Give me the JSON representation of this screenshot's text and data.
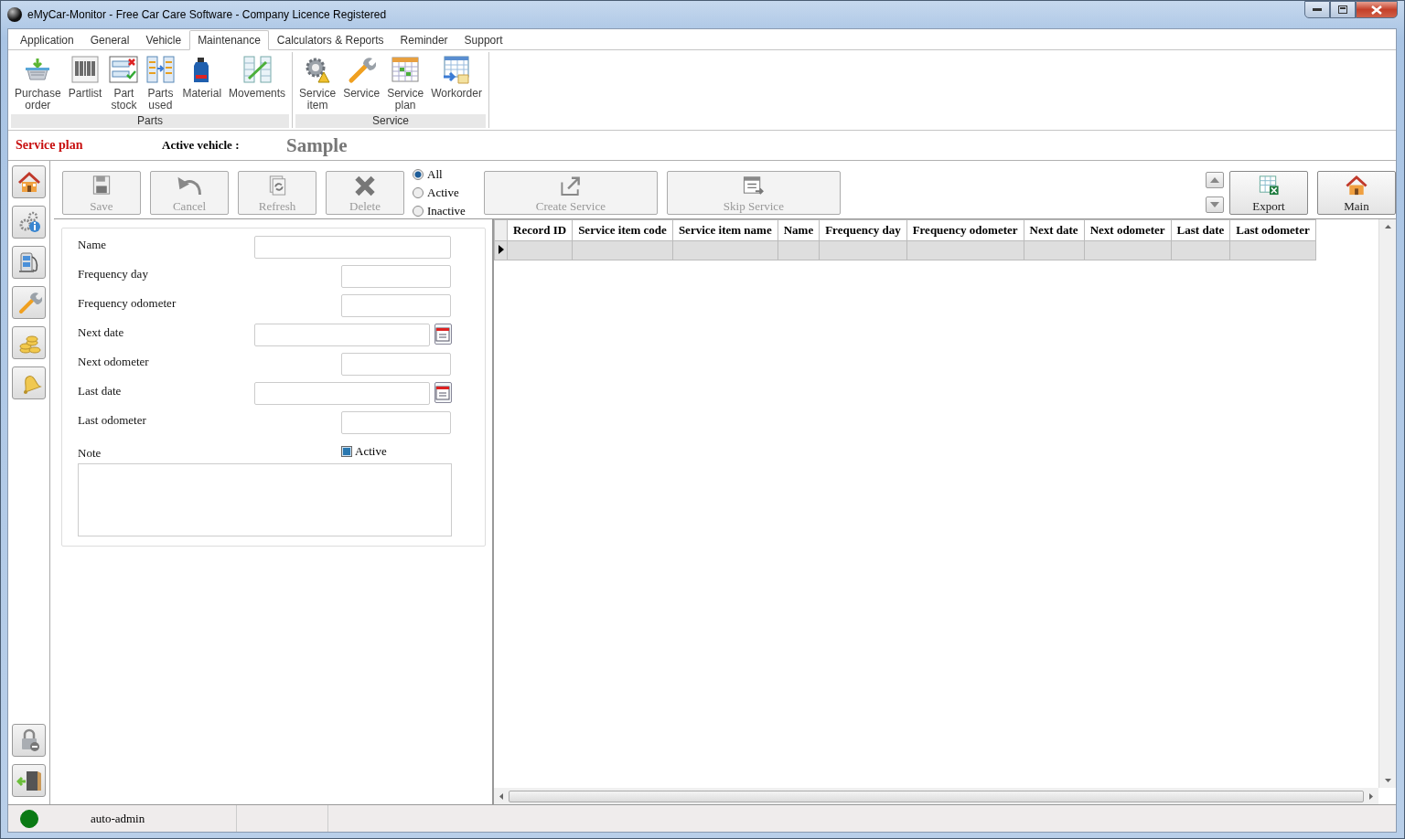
{
  "window": {
    "title": "eMyCar-Monitor - Free Car Care Software - Company Licence Registered"
  },
  "ribbon": {
    "tabs": [
      {
        "label": "Application",
        "selected": false
      },
      {
        "label": "General",
        "selected": false
      },
      {
        "label": "Vehicle",
        "selected": false
      },
      {
        "label": "Maintenance",
        "selected": true
      },
      {
        "label": "Calculators & Reports",
        "selected": false
      },
      {
        "label": "Reminder",
        "selected": false
      },
      {
        "label": "Support",
        "selected": false
      }
    ],
    "groups": [
      {
        "label": "Parts",
        "items": [
          {
            "label": "Purchase\norder"
          },
          {
            "label": "Partlist"
          },
          {
            "label": "Part\nstock"
          },
          {
            "label": "Parts\nused"
          },
          {
            "label": "Material"
          },
          {
            "label": "Movements"
          }
        ]
      },
      {
        "label": "Service",
        "items": [
          {
            "label": "Service\nitem"
          },
          {
            "label": "Service"
          },
          {
            "label": "Service\nplan"
          },
          {
            "label": "Workorder"
          }
        ]
      }
    ]
  },
  "page_header": {
    "title": "Service plan",
    "active_vehicle_label": "Active vehicle :",
    "active_vehicle": "Sample"
  },
  "toolbar": {
    "buttons": [
      {
        "label": "Save",
        "disabled": true
      },
      {
        "label": "Cancel",
        "disabled": true
      },
      {
        "label": "Refresh",
        "disabled": true
      },
      {
        "label": "Delete",
        "disabled": true
      }
    ],
    "filters": [
      {
        "label": "All",
        "selected": true
      },
      {
        "label": "Active",
        "selected": false
      },
      {
        "label": "Inactive",
        "selected": false
      }
    ],
    "actions": [
      {
        "label": "Create Service",
        "disabled": true
      },
      {
        "label": "Skip Service",
        "disabled": true
      }
    ],
    "nav_buttons": [
      {
        "label": "Export"
      },
      {
        "label": "Main"
      }
    ]
  },
  "form": {
    "fields": [
      {
        "label": "Name",
        "kind": "wide"
      },
      {
        "label": "Frequency day",
        "kind": "narrow"
      },
      {
        "label": "Frequency odometer",
        "kind": "narrow"
      },
      {
        "label": "Next date",
        "kind": "date"
      },
      {
        "label": "Next odometer",
        "kind": "narrow"
      },
      {
        "label": "Last date",
        "kind": "date"
      },
      {
        "label": "Last odometer",
        "kind": "narrow"
      }
    ],
    "note_label": "Note",
    "active_checkbox": {
      "label": "Active",
      "checked": true
    }
  },
  "grid": {
    "columns": [
      "Record ID",
      "Service item code",
      "Service item name",
      "Name",
      "Frequency day",
      "Frequency odometer",
      "Next date",
      "Next odometer",
      "Last date",
      "Last odometer"
    ],
    "rows": [
      {
        "current": true
      }
    ]
  },
  "status_bar": {
    "online": true,
    "user": "auto-admin"
  }
}
